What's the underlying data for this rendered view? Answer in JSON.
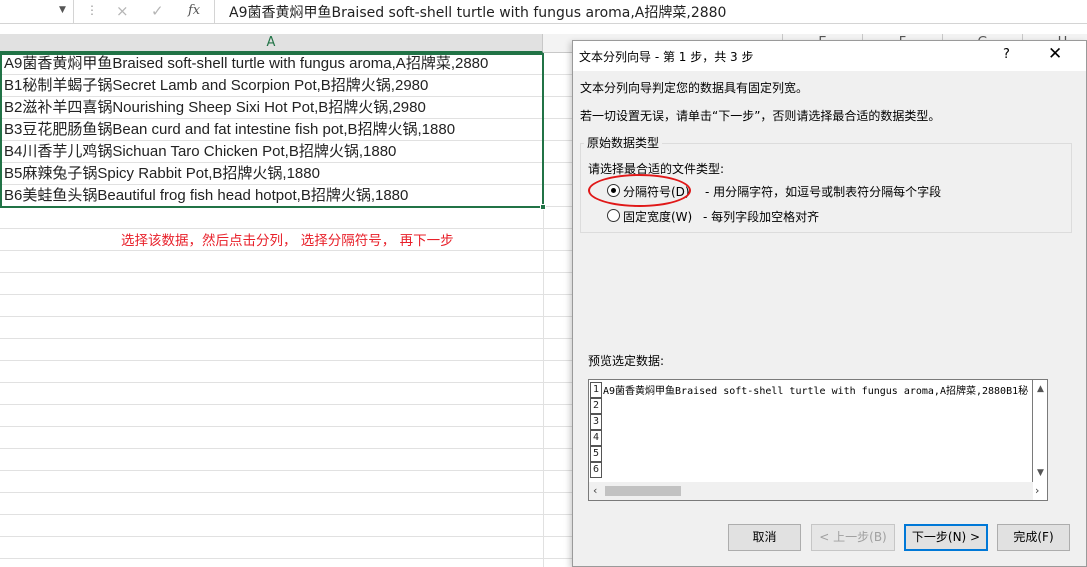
{
  "formula_bar": {
    "cancel_icon": "×",
    "enter_icon": "✓",
    "fx_label": "fx",
    "content": "A9菌香黄焖甲鱼Braised soft-shell turtle with fungus aroma,A招牌菜,2880"
  },
  "columns": [
    "A",
    "E",
    "F",
    "G",
    "H"
  ],
  "cells": [
    "A9菌香黄焖甲鱼Braised soft-shell turtle with fungus aroma,A招牌菜,2880",
    "B1秘制羊蝎子锅Secret Lamb and Scorpion Pot,B招牌火锅,2980",
    "B2滋补羊四喜锅Nourishing Sheep Sixi Hot Pot,B招牌火锅,2980",
    "B3豆花肥肠鱼锅Bean curd and fat intestine fish pot,B招牌火锅,1880",
    "B4川香芋儿鸡锅Sichuan Taro Chicken Pot,B招牌火锅,1880",
    "B5麻辣兔子锅Spicy Rabbit Pot,B招牌火锅,1880",
    "B6美蛙鱼头锅Beautiful frog fish head hotpot,B招牌火锅,1880"
  ],
  "annotation": "选择该数据，然后点击分列， 选择分隔符号， 再下一步",
  "dialog": {
    "title": "文本分列向导 - 第 1 步，共 3 步",
    "help": "?",
    "close": "✕",
    "intro1": "文本分列向导判定您的数据具有固定列宽。",
    "intro2": "若一切设置无误，请单击“下一步”，否则请选择最合适的数据类型。",
    "group_title": "原始数据类型",
    "choose_label": "请选择最合适的文件类型:",
    "options": [
      {
        "label": "分隔符号(D)",
        "desc": "- 用分隔字符，如逗号或制表符分隔每个字段",
        "selected": true
      },
      {
        "label": "固定宽度(W)",
        "desc": "- 每列字段加空格对齐",
        "selected": false
      }
    ],
    "preview_label": "预览选定数据:",
    "preview_rows": [
      "1",
      "2",
      "3",
      "4",
      "5",
      "6"
    ],
    "preview_line": "A9菌香黄焖甲鱼Braised soft-shell turtle with fungus aroma,A招牌菜,2880B1秘",
    "buttons": {
      "cancel": "取消",
      "back": "< 上一步(B)",
      "next": "下一步(N) >",
      "finish": "完成(F)"
    }
  }
}
